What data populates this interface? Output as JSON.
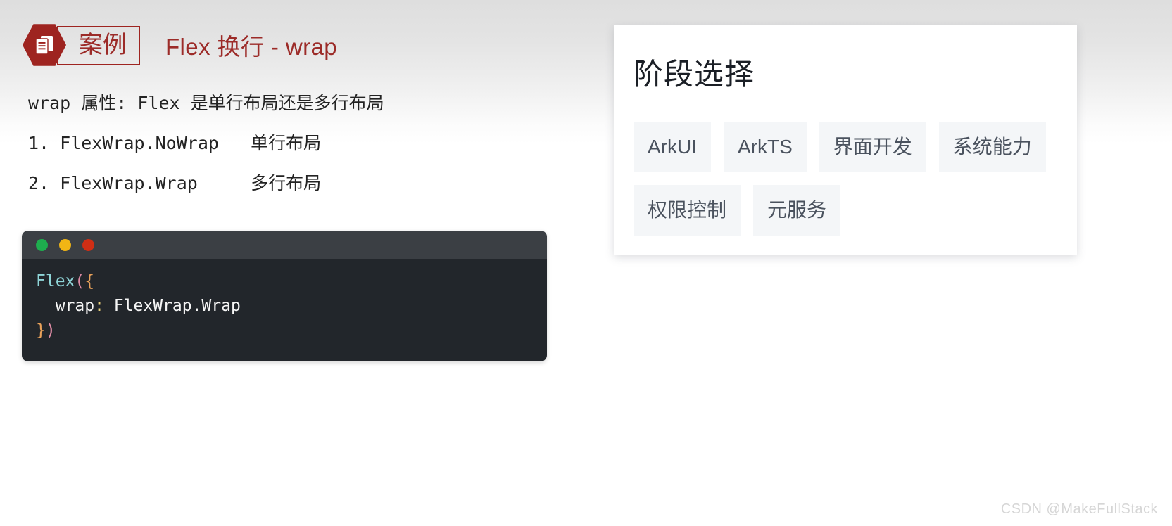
{
  "header": {
    "badge_icon": "document-list-icon",
    "badge_label": "案例",
    "title": "Flex 换行 - wrap",
    "accent_color": "#9c2b28"
  },
  "body": {
    "lines": [
      "wrap 属性: Flex 是单行布局还是多行布局",
      "1. FlexWrap.NoWrap   单行布局",
      "2. FlexWrap.Wrap     多行布局"
    ]
  },
  "code_card": {
    "window_dots": [
      "green",
      "yellow",
      "red"
    ],
    "dot_colors": {
      "green": "#1eae4e",
      "yellow": "#f1b515",
      "red": "#cf2e15"
    },
    "line1": {
      "fn": "Flex",
      "paren": "(",
      "brace": "{"
    },
    "line2": {
      "indent": "  ",
      "key": "wrap",
      "colon": ":",
      "value": " FlexWrap.Wrap"
    },
    "line3": {
      "brace": "}",
      "paren": ")"
    },
    "background": "#22262b",
    "titlebar": "#3b3f44"
  },
  "preview": {
    "title": "阶段选择",
    "chips": [
      "ArkUI",
      "ArkTS",
      "界面开发",
      "系统能力",
      "权限控制",
      "元服务"
    ],
    "chip_bg": "#f4f6f8",
    "chip_color": "#4a525e"
  },
  "watermark": {
    "text": "CSDN @MakeFullStack"
  }
}
